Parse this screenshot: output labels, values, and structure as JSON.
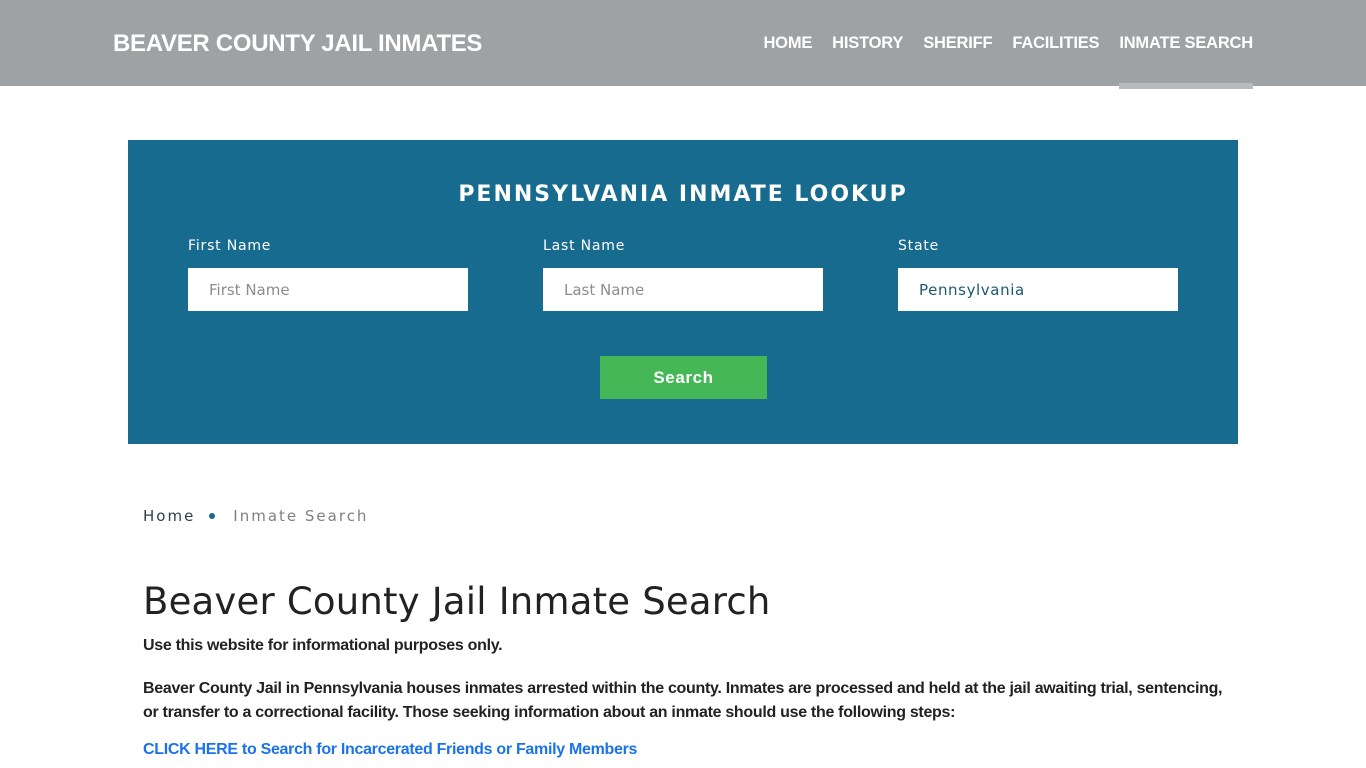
{
  "header": {
    "brand": "BEAVER COUNTY JAIL INMATES",
    "nav": [
      {
        "label": "HOME",
        "active": false
      },
      {
        "label": "HISTORY",
        "active": false
      },
      {
        "label": "SHERIFF",
        "active": false
      },
      {
        "label": "FACILITIES",
        "active": false
      },
      {
        "label": "INMATE SEARCH",
        "active": true
      }
    ]
  },
  "lookup": {
    "title": "PENNSYLVANIA INMATE LOOKUP",
    "fields": [
      {
        "label": "First Name",
        "placeholder": "First Name",
        "value": ""
      },
      {
        "label": "Last Name",
        "placeholder": "Last Name",
        "value": ""
      },
      {
        "label": "State",
        "placeholder": "",
        "value": "Pennsylvania"
      }
    ],
    "search_label": "Search"
  },
  "breadcrumb": {
    "home": "Home",
    "current": "Inmate Search"
  },
  "content": {
    "title": "Beaver County Jail Inmate Search",
    "note": "Use this website for informational purposes only.",
    "paragraph": "Beaver County Jail in Pennsylvania houses inmates arrested within the county. Inmates are processed and held at the jail awaiting trial, sentencing, or transfer to a correctional facility. Those seeking information about an inmate should use the following steps:",
    "cta_link": "CLICK HERE to Search for Incarcerated Friends or Family Members"
  },
  "colors": {
    "header_bg": "#9ea2a5",
    "lookup_bg": "#176b8e",
    "search_button": "#45b757",
    "link": "#1a73e8"
  }
}
